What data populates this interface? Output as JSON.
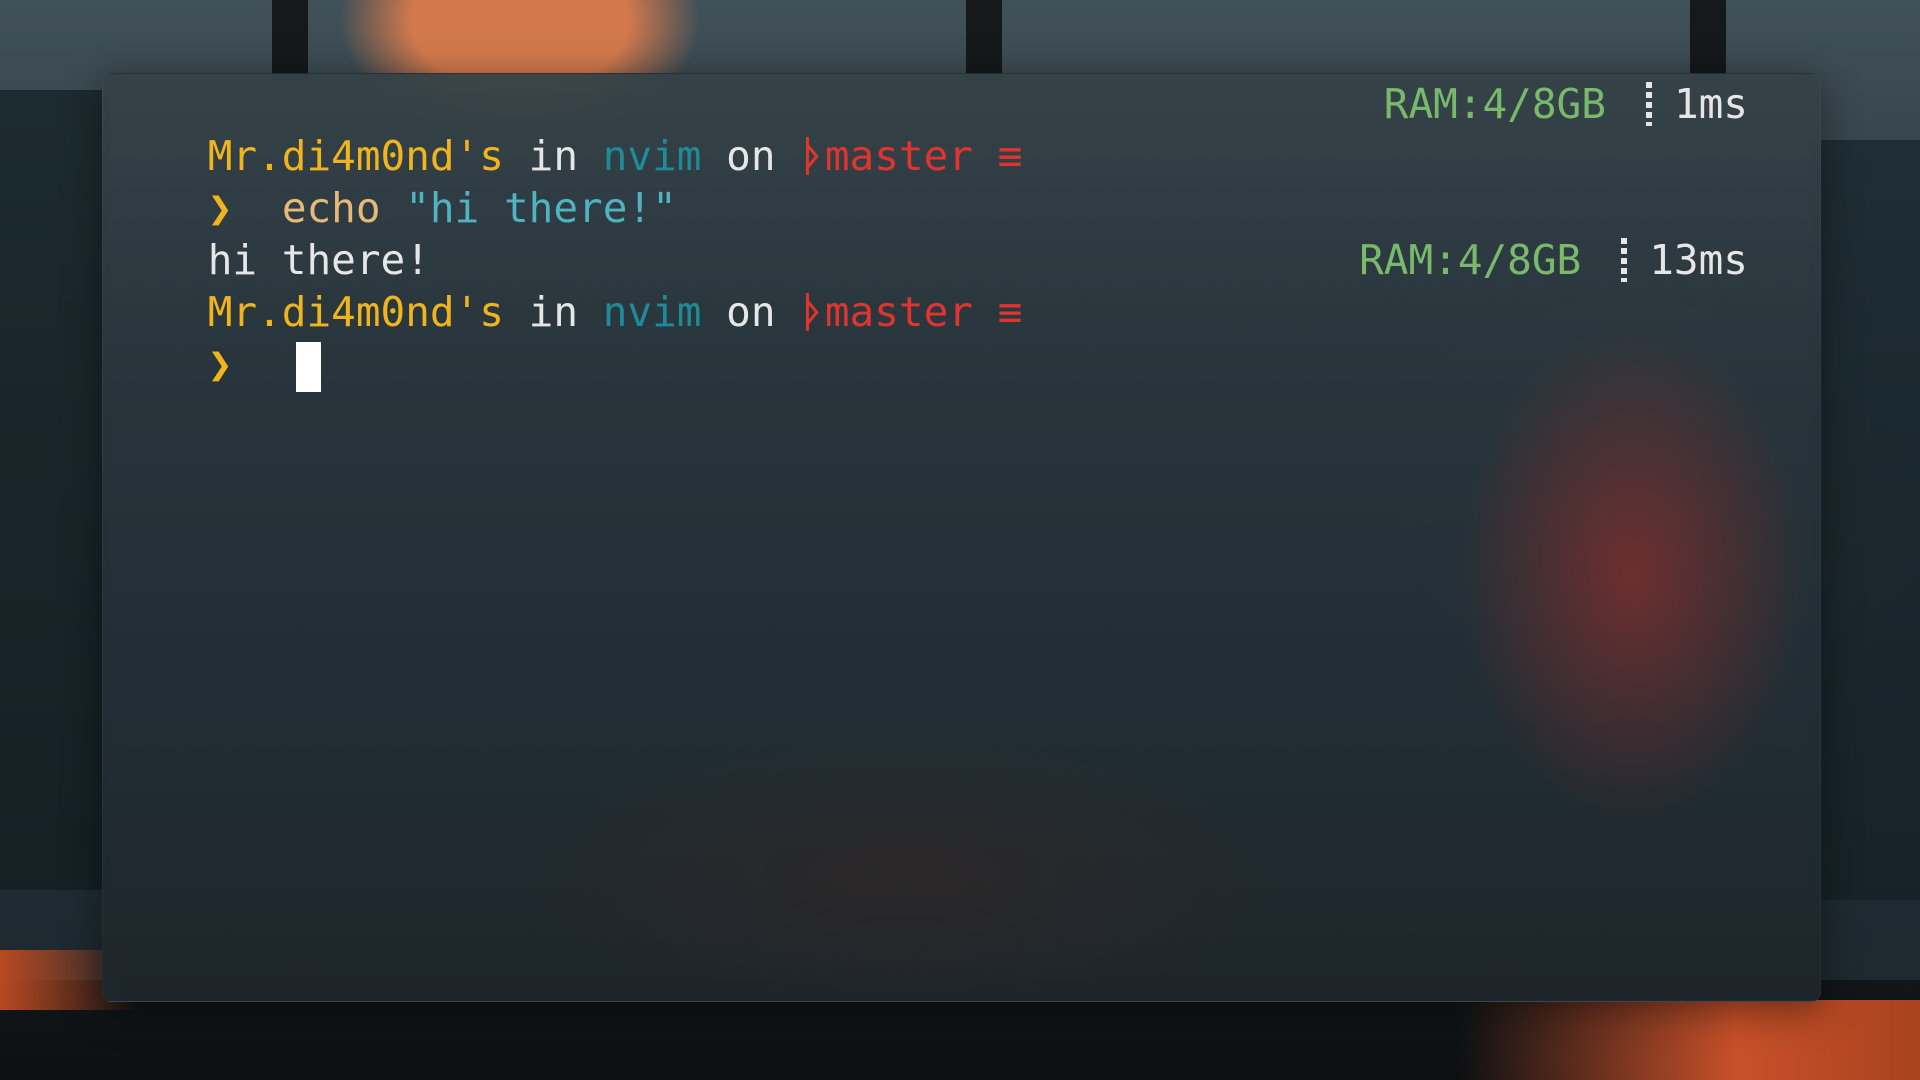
{
  "colors": {
    "user": "#f0b41e",
    "directory": "#1f8a98",
    "branch": "#e0342e",
    "ram": "#79b96b",
    "command": "#e7b978",
    "string": "#4fb3c2",
    "text": "#e6e6e6"
  },
  "prompts": [
    {
      "user": "Mr.di4m0nd's",
      "in_word": "in",
      "directory": "nvim",
      "on_word": "on",
      "branch_icon": "ᚦ",
      "branch": "master",
      "branch_status": "≡",
      "ram": "RAM:4/8GB",
      "duration": "1ms"
    },
    {
      "user": "Mr.di4m0nd's",
      "in_word": "in",
      "directory": "nvim",
      "on_word": "on",
      "branch_icon": "ᚦ",
      "branch": "master",
      "branch_status": "≡",
      "ram": "RAM:4/8GB",
      "duration": "13ms"
    }
  ],
  "command_line": {
    "arrow": "❯",
    "command": "echo",
    "argument": "\"hi there!\""
  },
  "output": "hi there!",
  "input_line": {
    "arrow": "❯"
  }
}
